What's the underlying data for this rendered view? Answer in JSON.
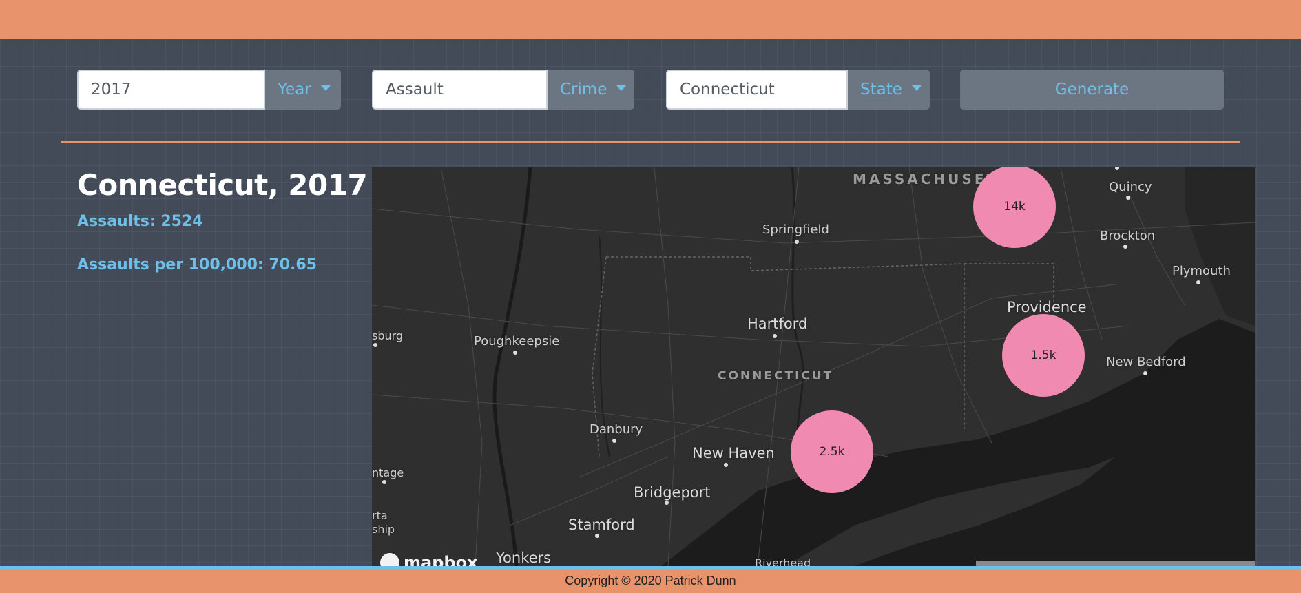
{
  "controls": {
    "year": {
      "value": "2017",
      "button": "Year"
    },
    "crime": {
      "value": "Assault",
      "button": "Crime"
    },
    "state": {
      "value": "Connecticut",
      "button": "State"
    },
    "generate": "Generate"
  },
  "info": {
    "title": "Connecticut, 2017",
    "assaults": "Assaults: 2524",
    "per_capita": "Assaults per 100,000: 70.65"
  },
  "map": {
    "labels": {
      "massachusetts": "MASSACHUSETTS",
      "connecticut": "CONNECTICUT",
      "springfield": "Springfield",
      "hartford": "Hartford",
      "providence": "Providence",
      "quincy": "Quincy",
      "brockton": "Brockton",
      "plymouth": "Plymouth",
      "new_bedford": "New Bedford",
      "poughkeepsie": "Poughkeepsie",
      "danbury": "Danbury",
      "new_haven": "New Haven",
      "bridgeport": "Bridgeport",
      "stamford": "Stamford",
      "yonkers": "Yonkers",
      "riverhead": "Riverhead",
      "sburg": "sburg",
      "ntage": "ntage",
      "rta": "rta",
      "ship": "ship"
    },
    "clusters": {
      "c1": "14k",
      "c2": "1.5k",
      "c3": "2.5k"
    },
    "logo": "mapbox"
  },
  "footer": "Copyright © 2020 Patrick Dunn",
  "colors": {
    "accent": "#e8936c",
    "link": "#6cc0ea",
    "cluster": "#f08ab0",
    "background": "#434b59"
  }
}
